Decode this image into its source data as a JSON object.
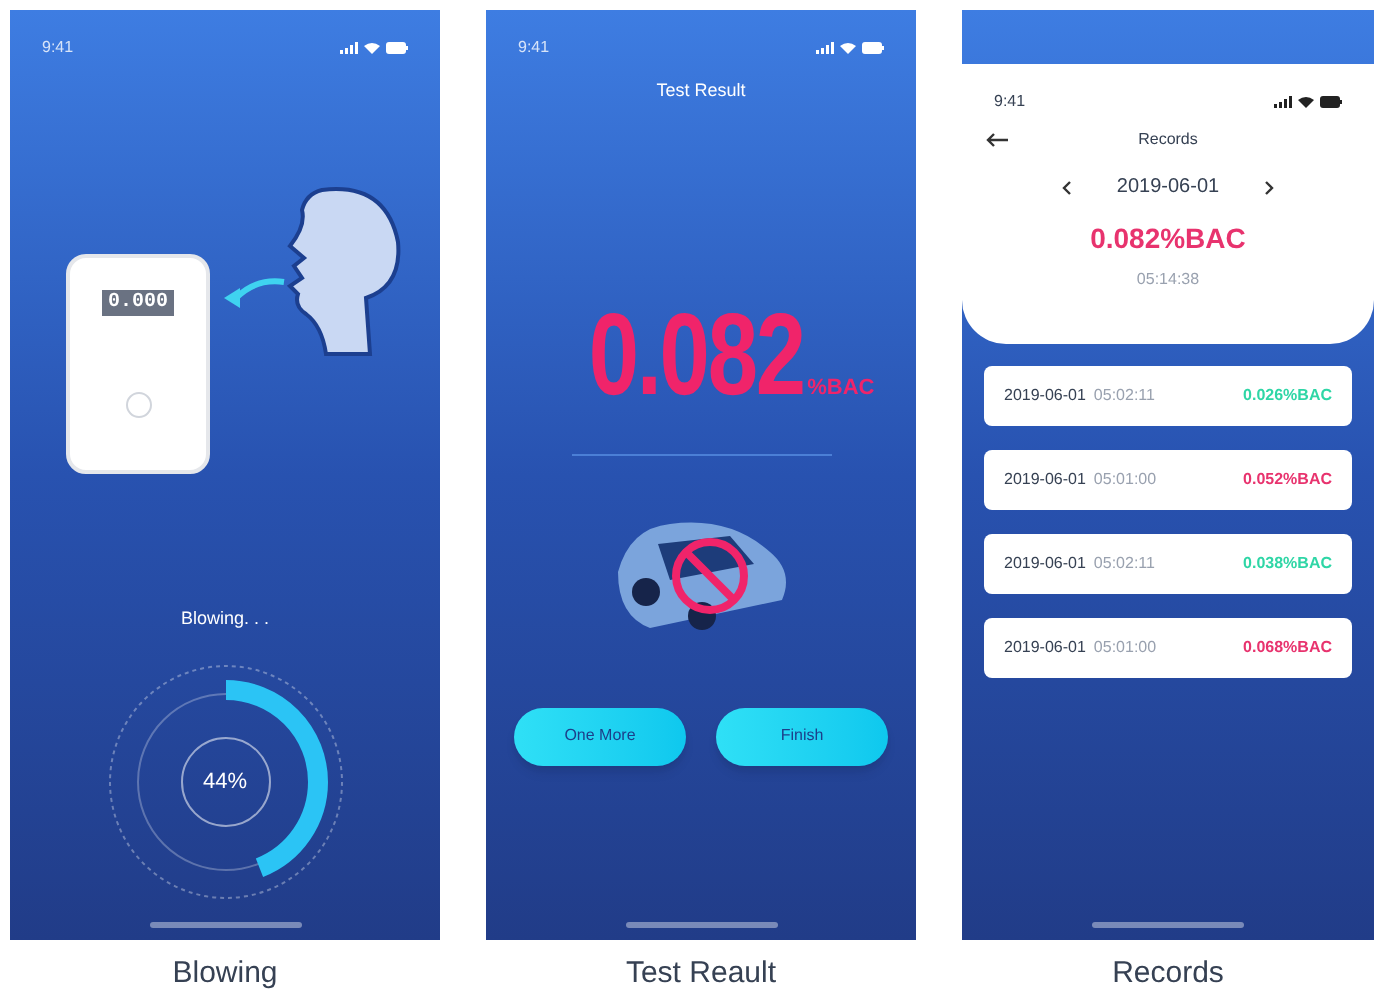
{
  "screens": [
    {
      "kind": "blowing",
      "status_time": "9:41",
      "device_reading": "0.000",
      "status_text": "Blowing. . .",
      "progress": {
        "level": 0.44,
        "label": "44%"
      },
      "caption": "Blowing"
    },
    {
      "kind": "result",
      "status_time": "9:41",
      "title": "Test Result",
      "value": "0.082",
      "unit": "%BAC",
      "buttons": [
        "One More",
        "Finish"
      ],
      "caption": "Test Reault"
    },
    {
      "kind": "records",
      "status_time": "9:41",
      "title": "Records",
      "date": "2019-06-01",
      "latest_value": "0.082%BAC",
      "latest_time": "05:14:38",
      "records": [
        {
          "date": "2019-06-01",
          "time": "05:02:11",
          "value": "0.026%BAC",
          "color": "#2fd6a6"
        },
        {
          "date": "2019-06-01",
          "time": "05:01:00",
          "value": "0.052%BAC",
          "color": "#e8336e"
        },
        {
          "date": "2019-06-01",
          "time": "05:02:11",
          "value": "0.038%BAC",
          "color": "#2fd6a6"
        },
        {
          "date": "2019-06-01",
          "time": "05:01:00",
          "value": "0.068%BAC",
          "color": "#e8336e"
        }
      ],
      "caption": "Records"
    }
  ]
}
